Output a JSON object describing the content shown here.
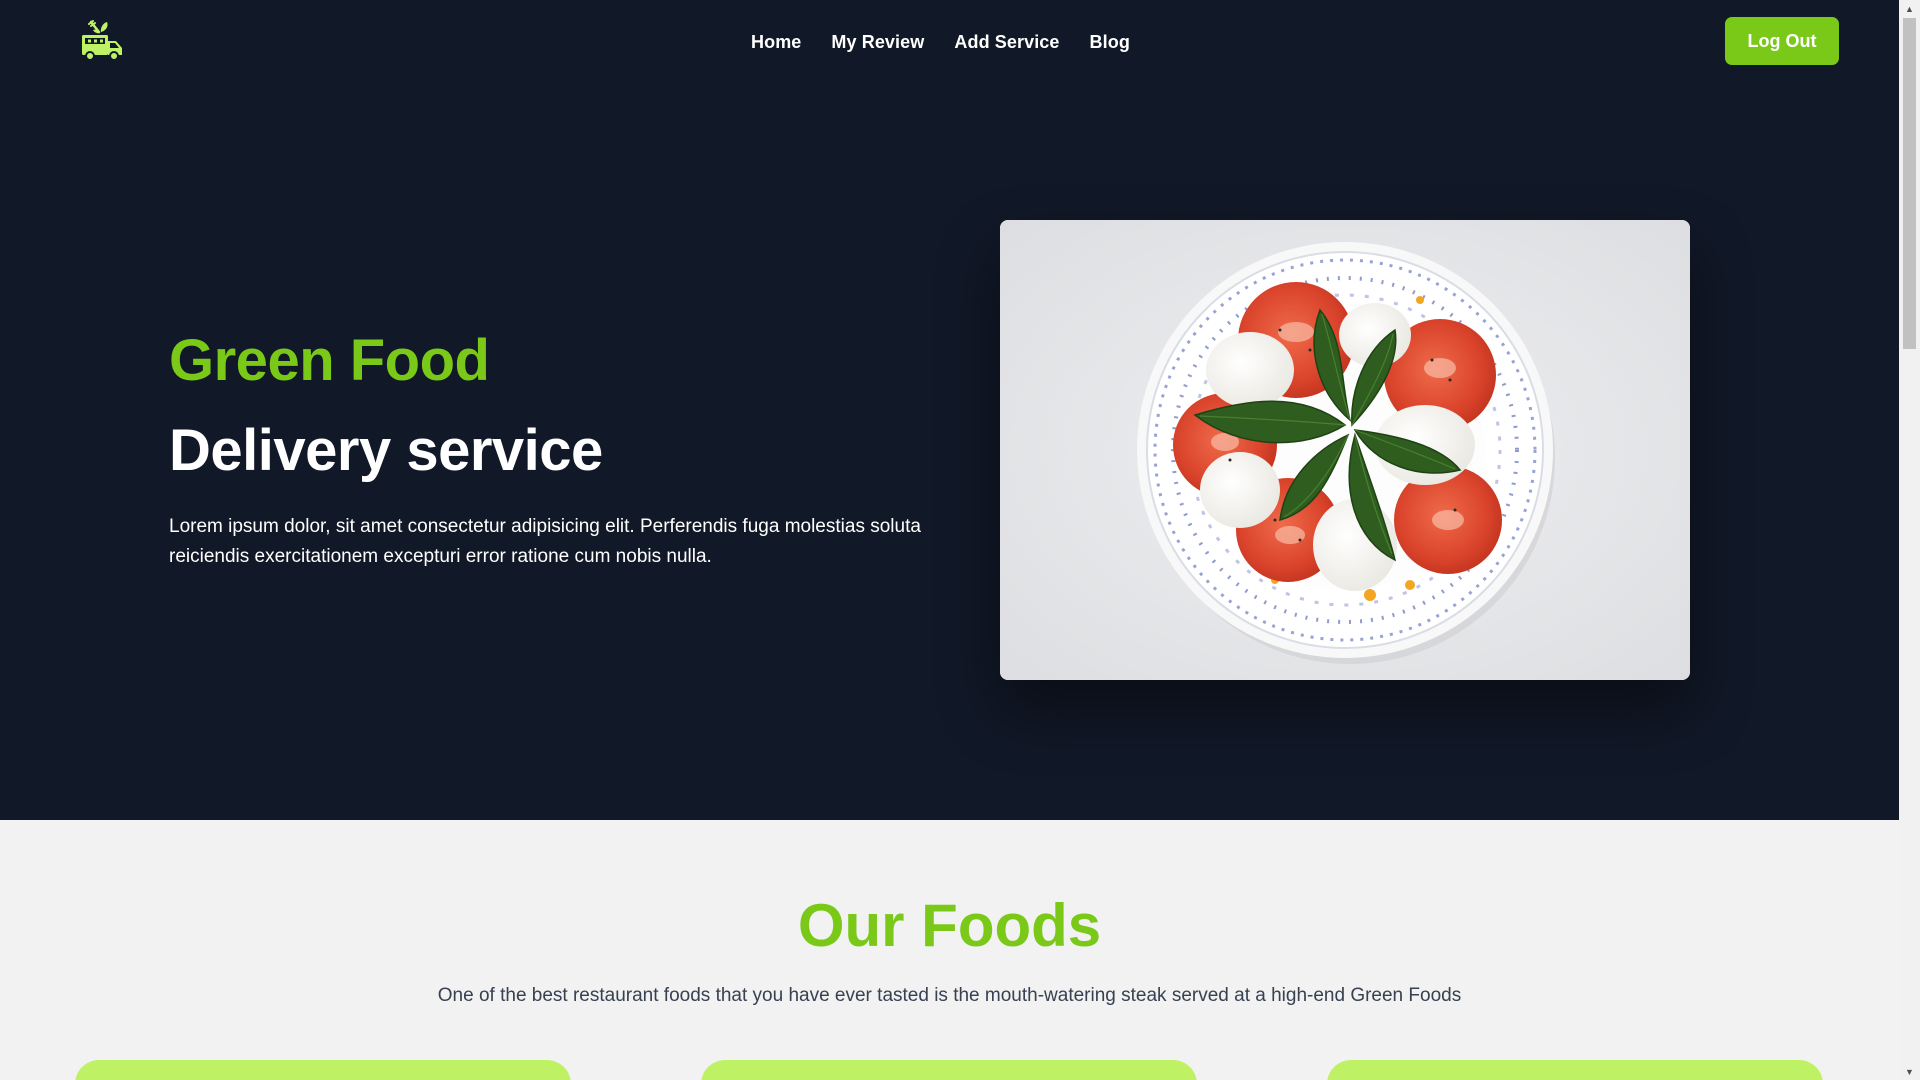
{
  "nav": {
    "logo_alt": "food truck logo",
    "links": [
      "Home",
      "My Review",
      "Add Service",
      "Blog"
    ],
    "logout_label": "Log Out"
  },
  "hero": {
    "title": "Green Food",
    "subtitle": "Delivery service",
    "description": "Lorem ipsum dolor, sit amet consectetur adipisicing elit. Perferendis fuga molestias soluta reiciendis exercitationem excepturi error ratione cum nobis nulla.",
    "image_subject": "caprese salad on decorated plate"
  },
  "foods": {
    "title": "Our Foods",
    "description": "One of the best restaurant foods that you have ever tasted is the mouth-watering steak served at a high-end Green Foods"
  },
  "colors": {
    "accent": "#7ac918",
    "navy": "#111827",
    "card_green": "#bef264"
  },
  "icons": {
    "logo": "food-truck-icon",
    "scroll_up": "chevron-up-icon",
    "scroll_down": "chevron-down-icon"
  }
}
